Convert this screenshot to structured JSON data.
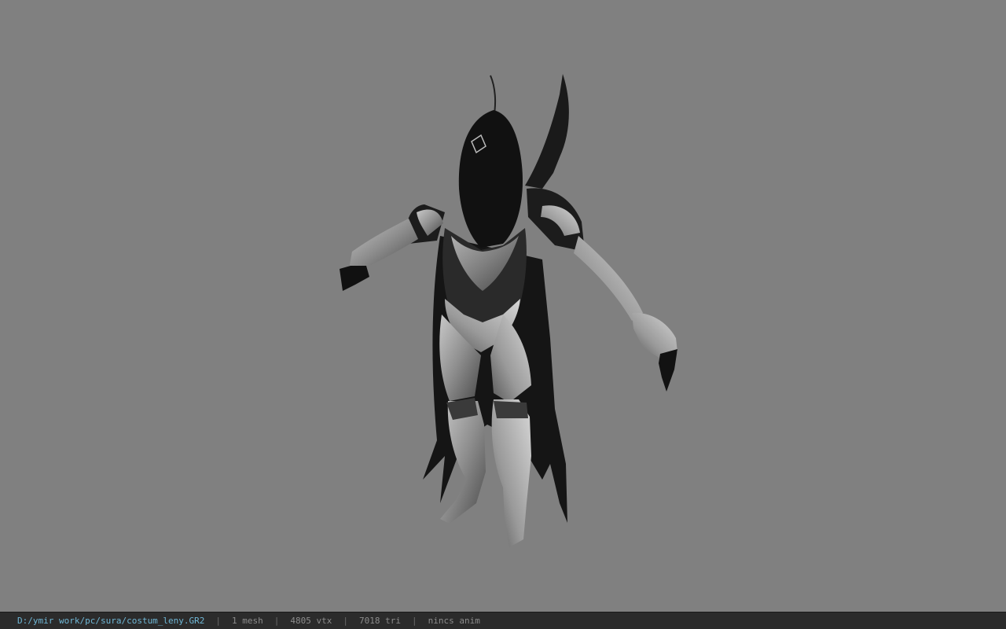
{
  "viewer": {
    "background_color": "#808080",
    "model_name": "costum_leny"
  },
  "status_bar": {
    "file_path": "D:/ymir work/pc/sura/costum_leny.GR2",
    "separator": "|",
    "mesh_count": "1 mesh",
    "vertex_count": "4805 vtx",
    "triangle_count": "7018 tri",
    "anim_status": "nincs anim",
    "path_color": "#6fb7d6",
    "text_color": "#8c8c8c",
    "bar_color": "#2b2b2b"
  }
}
